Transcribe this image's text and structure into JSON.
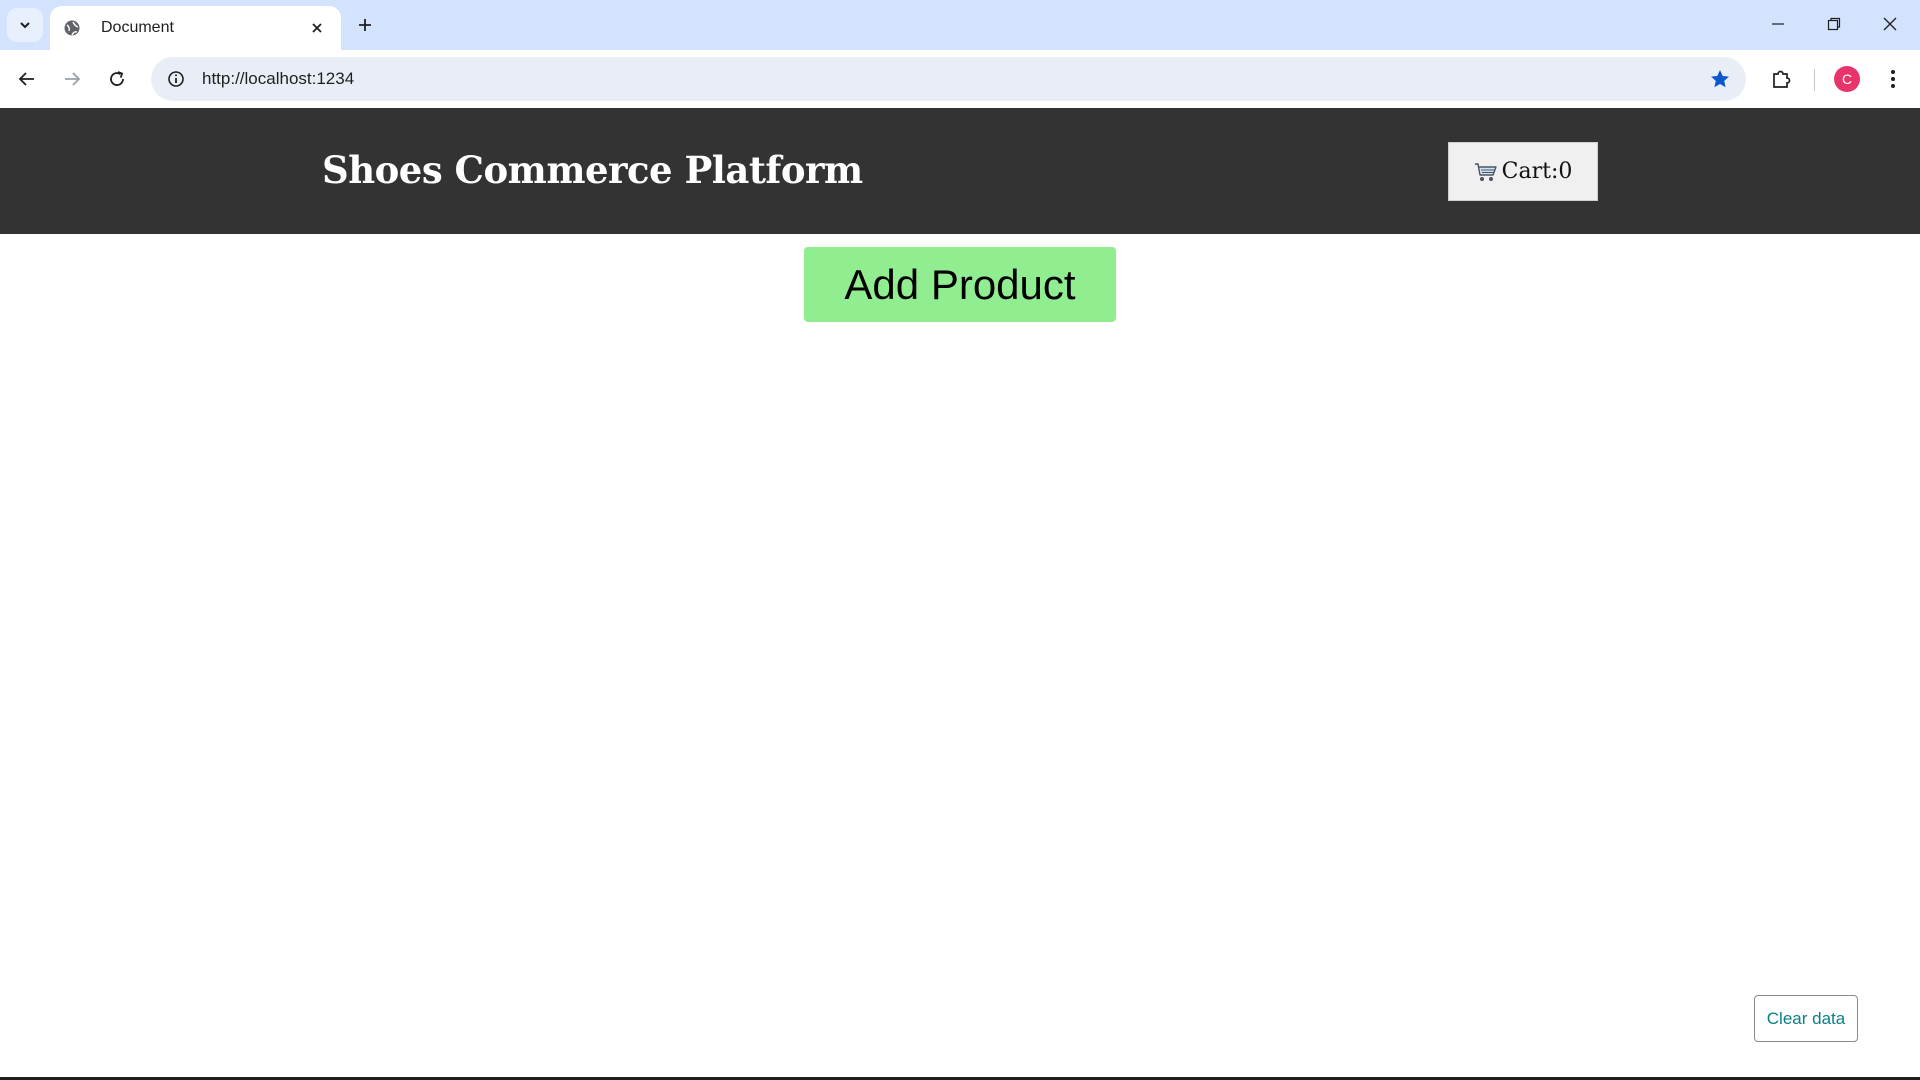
{
  "browser": {
    "tab_title": "Document",
    "url": "http://localhost:1234",
    "profile_initial": "C",
    "accent_color": "#0b57d0",
    "profile_color": "#e8336b"
  },
  "page": {
    "title": "Shoes Commerce Platform",
    "cart_label": "Cart:0",
    "add_product_label": "Add Product",
    "clear_label": "Clear data",
    "colors": {
      "header_bg": "#333333",
      "add_button_bg": "#90ee90",
      "clear_text": "#0b7f87"
    }
  },
  "icons": {
    "tab_search": "chevron-down-icon",
    "favicon": "globe-icon",
    "tab_close": "close-icon",
    "new_tab": "plus-icon",
    "back": "arrow-left-icon",
    "forward": "arrow-right-icon",
    "reload": "reload-icon",
    "site_info": "info-icon",
    "bookmark": "star-icon",
    "extensions": "puzzle-icon",
    "menu": "kebab-menu-icon",
    "cart": "shopping-cart-icon"
  }
}
